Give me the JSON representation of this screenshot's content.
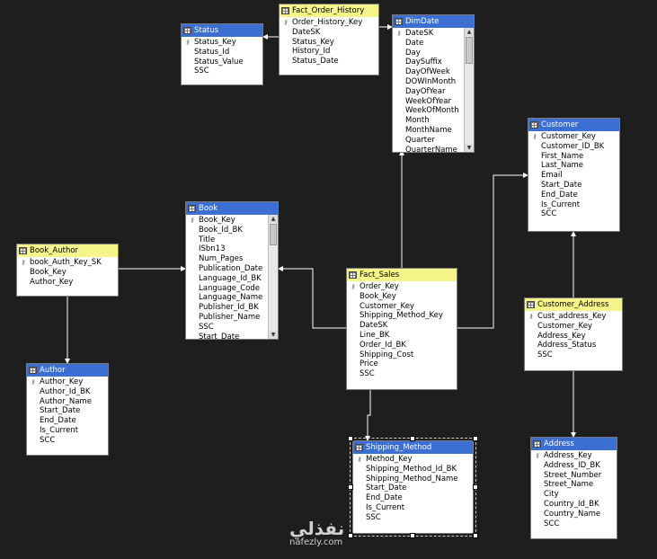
{
  "tables": [
    {
      "id": "status",
      "title": "Status",
      "header": "blue",
      "columns": [
        "Status_Key",
        "Status_Id",
        "Status_Value",
        "SSC"
      ],
      "key_rows": [
        0
      ]
    },
    {
      "id": "fact_order_history",
      "title": "Fact_Order_History",
      "header": "yellow",
      "columns": [
        "Order_History_Key",
        "DateSK",
        "Status_Key",
        "History_Id",
        "Status_Date"
      ],
      "key_rows": [
        0
      ]
    },
    {
      "id": "dimdate",
      "title": "DimDate",
      "header": "blue",
      "columns": [
        "DateSK",
        "Date",
        "Day",
        "DaySuffix",
        "DayOfWeek",
        "DOWInMonth",
        "DayOfYear",
        "WeekOfYear",
        "WeekOfMonth",
        "Month",
        "MonthName",
        "Quarter",
        "QuarterName"
      ],
      "key_rows": [
        0
      ],
      "scroll": true
    },
    {
      "id": "customer",
      "title": "Customer",
      "header": "blue",
      "columns": [
        "Customer_Key",
        "Customer_ID_BK",
        "First_Name",
        "Last_Name",
        "Email",
        "Start_Date",
        "End_Date",
        "Is_Current",
        "SCC"
      ],
      "key_rows": [
        0
      ]
    },
    {
      "id": "book",
      "title": "Book",
      "header": "blue",
      "columns": [
        "Book_Key",
        "Book_Id_BK",
        "Title",
        "ISbn13",
        "Num_Pages",
        "Publication_Date",
        "Language_Id_BK",
        "Language_Code",
        "Language_Name",
        "Publisher_Id_BK",
        "Publisher_Name",
        "SSC",
        "Start_Date"
      ],
      "key_rows": [
        0
      ],
      "scroll": true
    },
    {
      "id": "book_author",
      "title": "Book_Author",
      "header": "yellow",
      "columns": [
        "book_Auth_Key_SK",
        "Book_Key",
        "Author_Key"
      ],
      "key_rows": [
        0
      ]
    },
    {
      "id": "fact_sales",
      "title": "Fact_Sales",
      "header": "yellow",
      "columns": [
        "Order_Key",
        "Book_Key",
        "Customer_Key",
        "Shipping_Method_Key",
        "DateSK",
        "Line_BK",
        "Order_Id_BK",
        "Shipping_Cost",
        "Price",
        "SSC"
      ],
      "key_rows": [
        0
      ]
    },
    {
      "id": "customer_address",
      "title": "Customer_Address",
      "header": "yellow",
      "columns": [
        "Cust_address_Key",
        "Customer_Key",
        "Address_Key",
        "Address_Status",
        "SSC"
      ],
      "key_rows": [
        0
      ]
    },
    {
      "id": "author",
      "title": "Author",
      "header": "blue",
      "columns": [
        "Author_Key",
        "Author_Id_BK",
        "Author_Name",
        "Start_Date",
        "End_Date",
        "Is_Current",
        "SCC"
      ],
      "key_rows": [
        0
      ]
    },
    {
      "id": "shipping_method",
      "title": "Shipping_Method",
      "header": "blue",
      "columns": [
        "Method_Key",
        "Shipping_Method_Id_BK",
        "Shipping_Method_Name",
        "Start_Date",
        "End_Date",
        "Is_Current",
        "SSC"
      ],
      "key_rows": [
        0
      ],
      "selected": true
    },
    {
      "id": "address",
      "title": "Address",
      "header": "blue",
      "columns": [
        "Address_Key",
        "Address_ID_BK",
        "Street_Number",
        "Street_Name",
        "City",
        "Country_Id_BK",
        "Country_Name",
        "SCC"
      ],
      "key_rows": [
        0
      ]
    }
  ],
  "icons": {
    "table": "table-icon",
    "key": "key-icon"
  },
  "colors": {
    "background": "#1e1e1e",
    "header_blue": "#3b6fd4",
    "header_yellow": "#f5f58a",
    "line": "#ffffff"
  },
  "watermark": {
    "arabic": "نفذلي",
    "latin": "nafezly.com"
  }
}
